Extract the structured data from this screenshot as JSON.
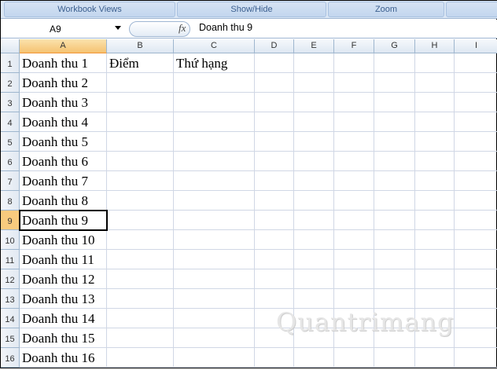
{
  "ribbon": {
    "groups": [
      "Workbook Views",
      "Show/Hide",
      "Zoom"
    ]
  },
  "formula_bar": {
    "name_box": "A9",
    "fx_label": "fx",
    "value": "Doanh thu 9"
  },
  "columns": [
    "A",
    "B",
    "C",
    "D",
    "E",
    "F",
    "G",
    "H",
    "I"
  ],
  "rows": [
    "1",
    "2",
    "3",
    "4",
    "5",
    "6",
    "7",
    "8",
    "9",
    "10",
    "11",
    "12",
    "13",
    "14",
    "15",
    "16"
  ],
  "cells": {
    "A": [
      "Doanh thu 1",
      "Doanh thu 2",
      "Doanh thu 3",
      "Doanh thu 4",
      "Doanh thu 5",
      "Doanh thu 6",
      "Doanh thu 7",
      "Doanh thu 8",
      "Doanh thu 9",
      "Doanh thu 10",
      "Doanh thu 11",
      "Doanh thu 12",
      "Doanh thu 13",
      "Doanh thu 14",
      "Doanh thu 15",
      "Doanh thu 16"
    ],
    "B1": "Điểm",
    "C1": "Thứ hạng"
  },
  "active_cell": {
    "col": "A",
    "row": 9
  },
  "watermark": "Quantrimang"
}
